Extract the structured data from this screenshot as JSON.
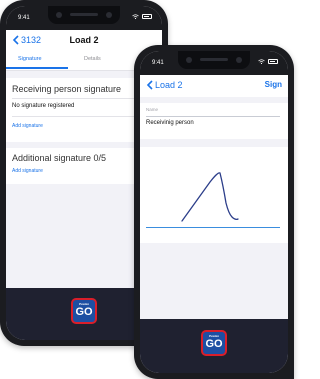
{
  "status_bar": {
    "time": "9:41"
  },
  "phone_back": {
    "back_label": "3132",
    "title": "Load 2",
    "tabs": [
      {
        "label": "Signature"
      },
      {
        "label": "Details"
      }
    ],
    "receiving_title": "Receiving person signature",
    "no_signature_text": "No signature registered",
    "add_signature_label": "Add signature",
    "additional_title": "Additional signature 0/5",
    "add_signature_label_2": "Add signature"
  },
  "phone_front": {
    "back_label": "Load 2",
    "sign_label": "Sign",
    "name_label": "Name",
    "name_value": "Receivinig person"
  },
  "logo": {
    "small_text": "Posten",
    "text": "GO"
  },
  "colors": {
    "accent": "#1a73e8",
    "bottom_bar": "#1f2130",
    "logo_red": "#d91e2a",
    "logo_blue": "#1d4fa3"
  }
}
